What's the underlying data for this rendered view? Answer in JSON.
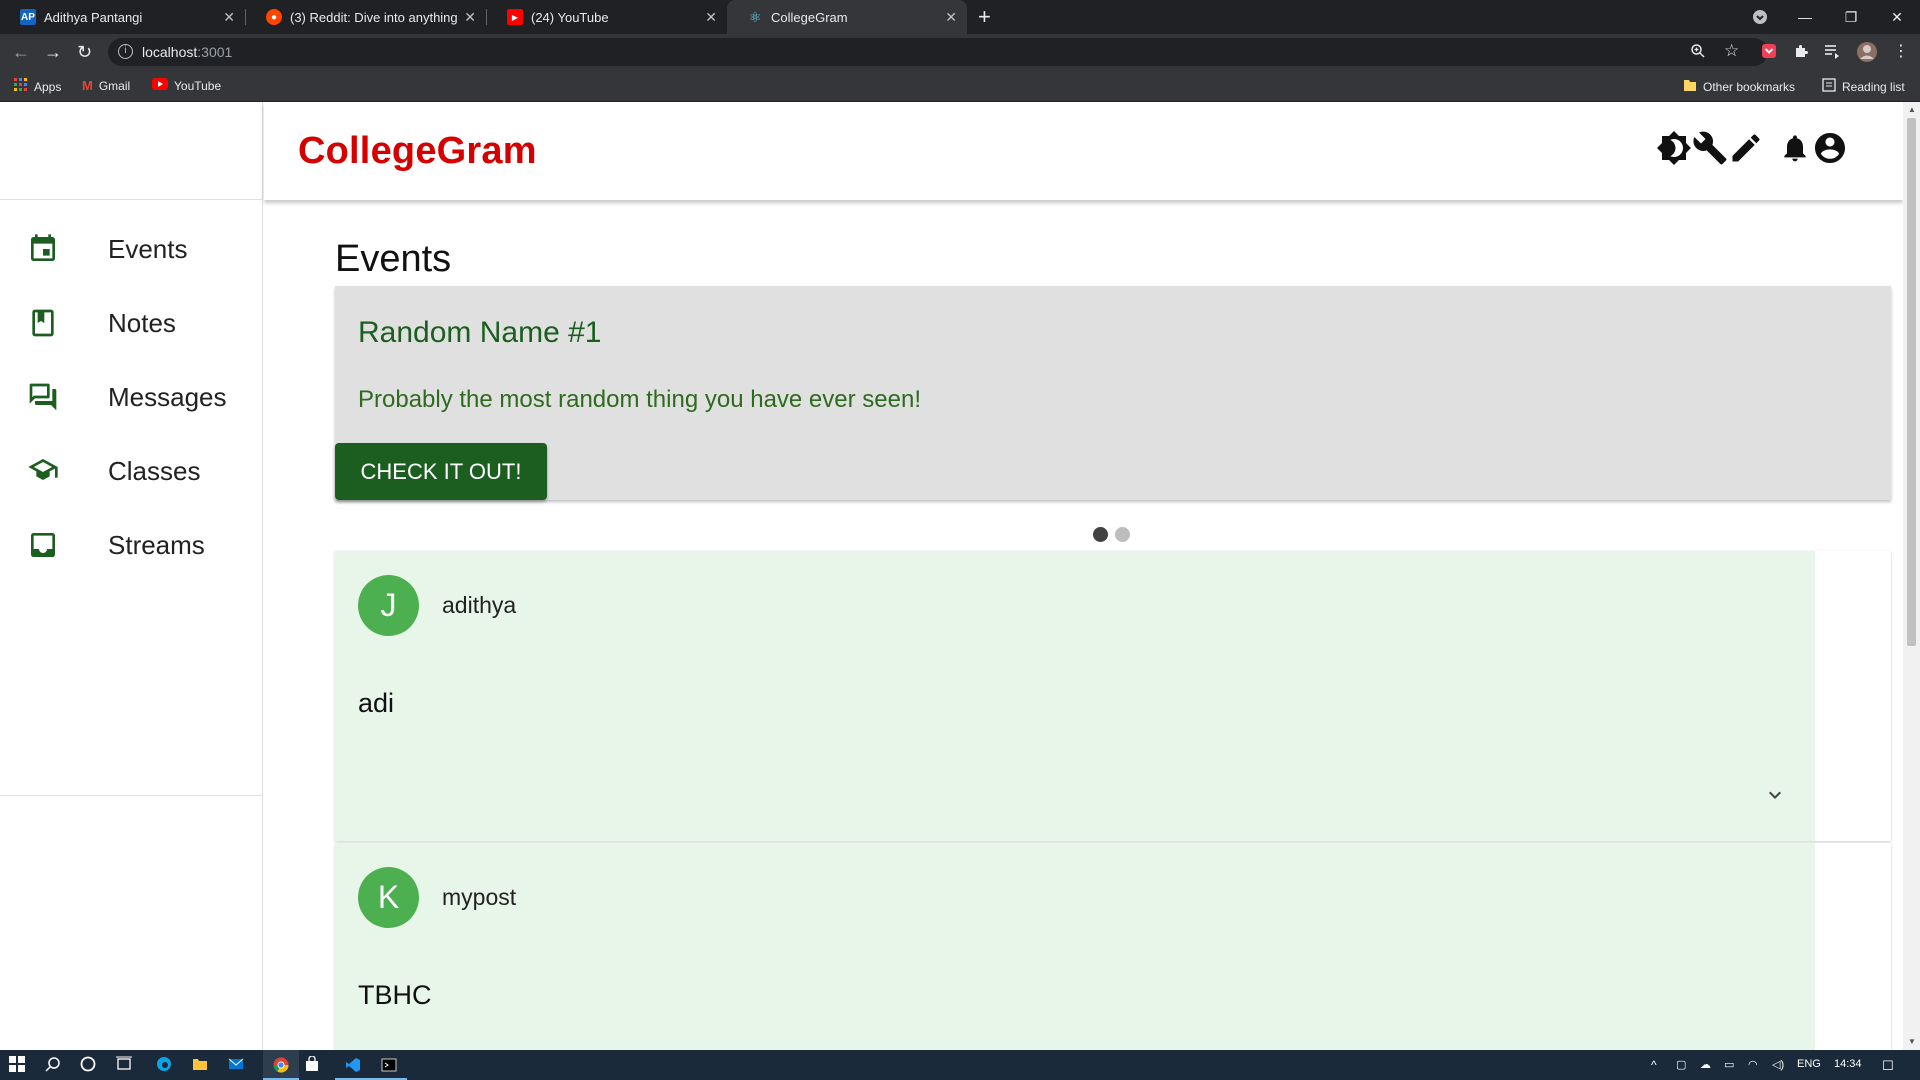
{
  "browser": {
    "tabs": [
      {
        "title": "Adithya Pantangi",
        "icon": "AP"
      },
      {
        "title": "(3) Reddit: Dive into anything",
        "icon": "reddit-icon"
      },
      {
        "title": "(24) YouTube",
        "icon": "youtube-icon"
      },
      {
        "title": "CollegeGram",
        "icon": "react-icon",
        "active": true
      }
    ],
    "url_host": "localhost",
    "url_port": ":3001",
    "bookmarks": [
      "Apps",
      "Gmail",
      "YouTube"
    ],
    "other_bookmarks": "Other bookmarks",
    "reading_list": "Reading list"
  },
  "header": {
    "logo": "CollegeGram",
    "icons": [
      "brightness-icon",
      "wrench-icon",
      "pencil-icon",
      "bell-icon",
      "account-icon"
    ]
  },
  "sidebar": {
    "items": [
      {
        "label": "Events",
        "icon": "calendar-icon"
      },
      {
        "label": "Notes",
        "icon": "bookmark-book-icon"
      },
      {
        "label": "Messages",
        "icon": "forum-icon"
      },
      {
        "label": "Classes",
        "icon": "school-icon"
      },
      {
        "label": "Streams",
        "icon": "inbox-icon"
      }
    ]
  },
  "main": {
    "title": "Events",
    "carousel": {
      "title": "Random Name #1",
      "description": "Probably the most random thing you have ever seen!",
      "button": "CHECK IT OUT!",
      "slide_count": 2,
      "active_slide": 1
    },
    "posts": [
      {
        "avatar": "J",
        "user": "adithya",
        "body": "adi"
      },
      {
        "avatar": "K",
        "user": "mypost",
        "body": "TBHC"
      }
    ]
  },
  "taskbar": {
    "lang": "ENG",
    "time": "14:34"
  },
  "colors": {
    "brand": "#d50000",
    "primary_green": "#1b5e20",
    "card_bg": "#e0e0e0",
    "post_bg": "#e8f5e9",
    "avatar": "#4caf50"
  }
}
